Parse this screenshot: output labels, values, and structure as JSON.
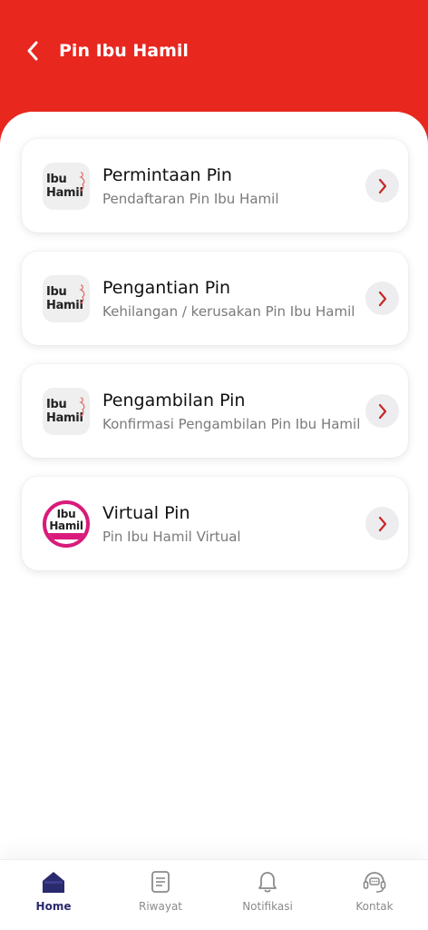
{
  "header": {
    "title": "Pin Ibu Hamil",
    "back_icon": "chevron-left-icon",
    "color": "#E8271F"
  },
  "cards": [
    {
      "title": "Permintaan Pin",
      "subtitle": "Pendaftaran Pin Ibu Hamil",
      "logo_lines": [
        "Ibu",
        "Hamil"
      ],
      "chevron_icon": "chevron-right-icon"
    },
    {
      "title": "Pengantian Pin",
      "subtitle": "Kehilangan / kerusakan Pin Ibu Hamil",
      "logo_lines": [
        "Ibu",
        "Hamil"
      ],
      "chevron_icon": "chevron-right-icon"
    },
    {
      "title": "Pengambilan Pin",
      "subtitle": "Konfirmasi Pengambilan Pin Ibu Hamil",
      "logo_lines": [
        "Ibu",
        "Hamil"
      ],
      "chevron_icon": "chevron-right-icon"
    },
    {
      "title": "Virtual Pin",
      "subtitle": "Pin Ibu Hamil Virtual",
      "logo_lines": [
        "Ibu",
        "Hamil"
      ],
      "chevron_icon": "chevron-right-icon"
    }
  ],
  "bottom_nav": {
    "items": [
      {
        "label": "Home",
        "icon": "home-icon",
        "active": true
      },
      {
        "label": "Riwayat",
        "icon": "document-icon",
        "active": false
      },
      {
        "label": "Notifikasi",
        "icon": "bell-icon",
        "active": false
      },
      {
        "label": "Kontak",
        "icon": "headset-chat-icon",
        "active": false
      }
    ],
    "active_color": "#2A2A6E",
    "inactive_color": "#8A8A8A"
  },
  "colors": {
    "chevron": "#C62828",
    "virtual_logo_ring": "#D81B7A"
  }
}
